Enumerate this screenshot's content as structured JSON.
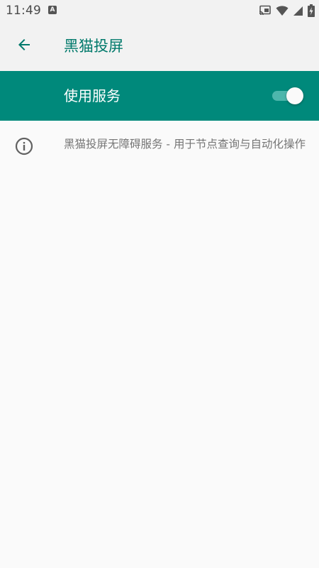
{
  "status_bar": {
    "time": "11:49",
    "notification_glyph": "A",
    "icons": [
      "cast-icon",
      "wifi-icon",
      "signal-icon",
      "battery-charging-icon"
    ]
  },
  "app_bar": {
    "back_icon": "arrow-left-icon",
    "title": "黑猫投屏"
  },
  "service_toggle": {
    "label": "使用服务",
    "enabled": true
  },
  "info": {
    "icon": "info-icon",
    "text": "黑猫投屏无障碍服务 - 用于节点查询与自动化操作"
  },
  "colors": {
    "primary": "#00897b",
    "primary_dark_text": "#00796b",
    "switch_track": "#4db6ac",
    "background": "#fafafa",
    "secondary_text": "#757575"
  }
}
